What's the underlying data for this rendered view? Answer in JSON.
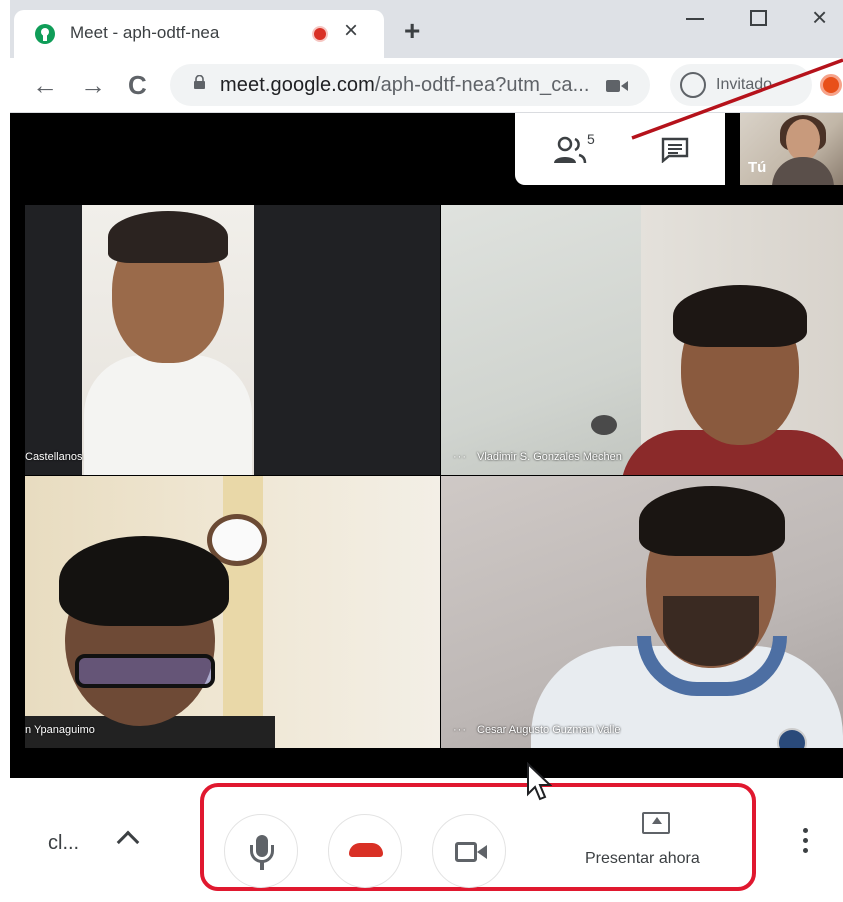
{
  "browser": {
    "tab_title": "Meet - aph-odtf-nea",
    "tab_close": "×",
    "new_tab": "+",
    "window_minimize": "–",
    "window_close": "×",
    "nav_back": "←",
    "nav_forward": "→",
    "nav_reload": "C",
    "url_host": "meet.google.com",
    "url_path": "/aph-odtf-nea?utm_ca...",
    "profile_label": "Invitado"
  },
  "meet": {
    "people_count": "5",
    "self_view_label": "Tú",
    "participants": [
      {
        "name": "Castellanos"
      },
      {
        "name": "Vladimir S. Gonzales Mechen"
      },
      {
        "name": "n Ypanaguimo"
      },
      {
        "name": "Cesar Augusto Guzman Valle"
      }
    ],
    "tile_more": "···",
    "meeting_code": "cl..."
  },
  "controls": {
    "present_label": "Presentar ahora"
  },
  "colors": {
    "annotation_red": "#e0182f",
    "hangup_red": "#d93025"
  }
}
